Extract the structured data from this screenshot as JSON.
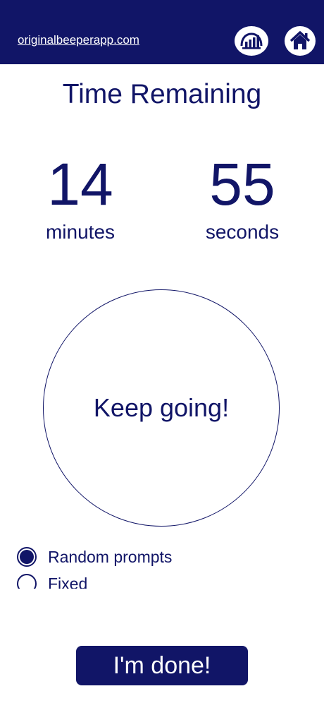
{
  "header": {
    "site_link": "originalbeeperapp.com",
    "stats_icon": "bar-chart-icon",
    "home_icon": "home-icon",
    "bg_color": "#111567"
  },
  "title": "Time Remaining",
  "timer": {
    "minutes": "14",
    "minutes_label": "minutes",
    "seconds": "55",
    "seconds_label": "seconds"
  },
  "status_circle": {
    "text": "Keep going!"
  },
  "options": [
    {
      "label": "Random prompts",
      "selected": true
    },
    {
      "label": "Fixed",
      "selected": false
    }
  ],
  "done_button": {
    "label": "I'm done!"
  },
  "colors": {
    "accent": "#111567",
    "background": "#ffffff"
  }
}
